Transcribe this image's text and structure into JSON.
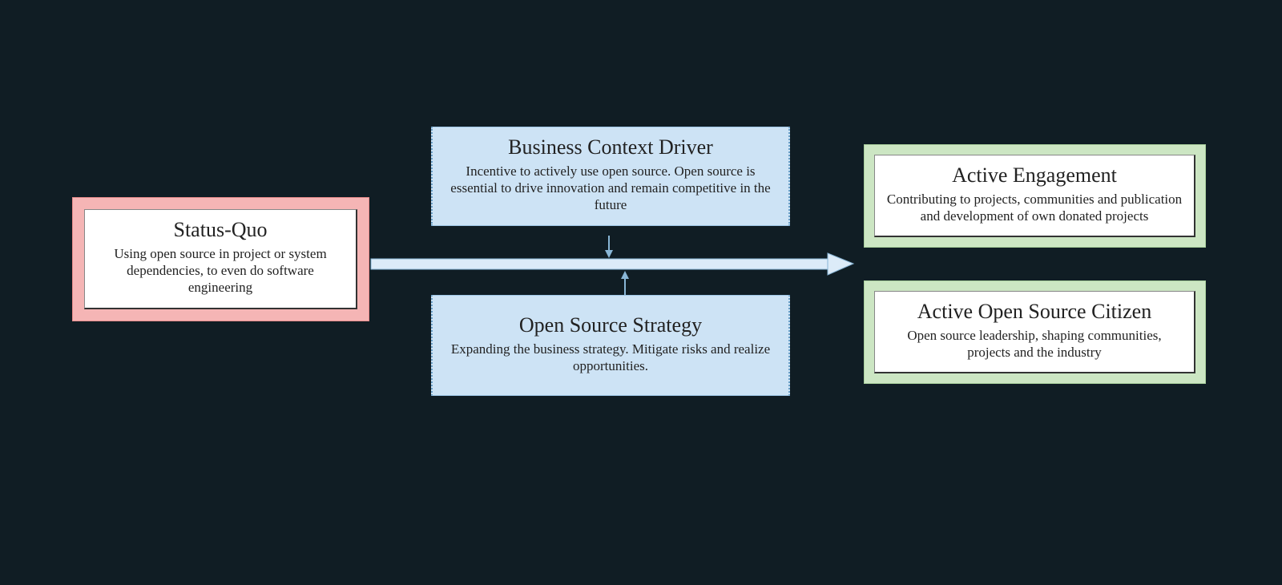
{
  "colors": {
    "background": "#101d24",
    "red_fill": "#f5b5b5",
    "blue_fill": "#cde3f5",
    "green_fill": "#cce6c3",
    "arrow_fill": "#dcebf8",
    "arrow_stroke": "#89b6d6"
  },
  "statusQuo": {
    "title": "Status-Quo",
    "desc": "Using open source in project or system dependencies, to even do software engineering"
  },
  "businessDriver": {
    "title": "Business Context Driver",
    "desc": "Incentive to actively use open source. Open source is essential to drive innovation and remain competitive in the future"
  },
  "strategy": {
    "title": "Open Source Strategy",
    "desc": "Expanding the business strategy. Mitigate risks and realize opportunities."
  },
  "activeEngagement": {
    "title": "Active Engagement",
    "desc": "Contributing to projects, communities and publication and development of own donated projects"
  },
  "citizen": {
    "title": "Active Open Source Citizen",
    "desc": "Open source leadership, shaping communities, projects and the industry"
  }
}
